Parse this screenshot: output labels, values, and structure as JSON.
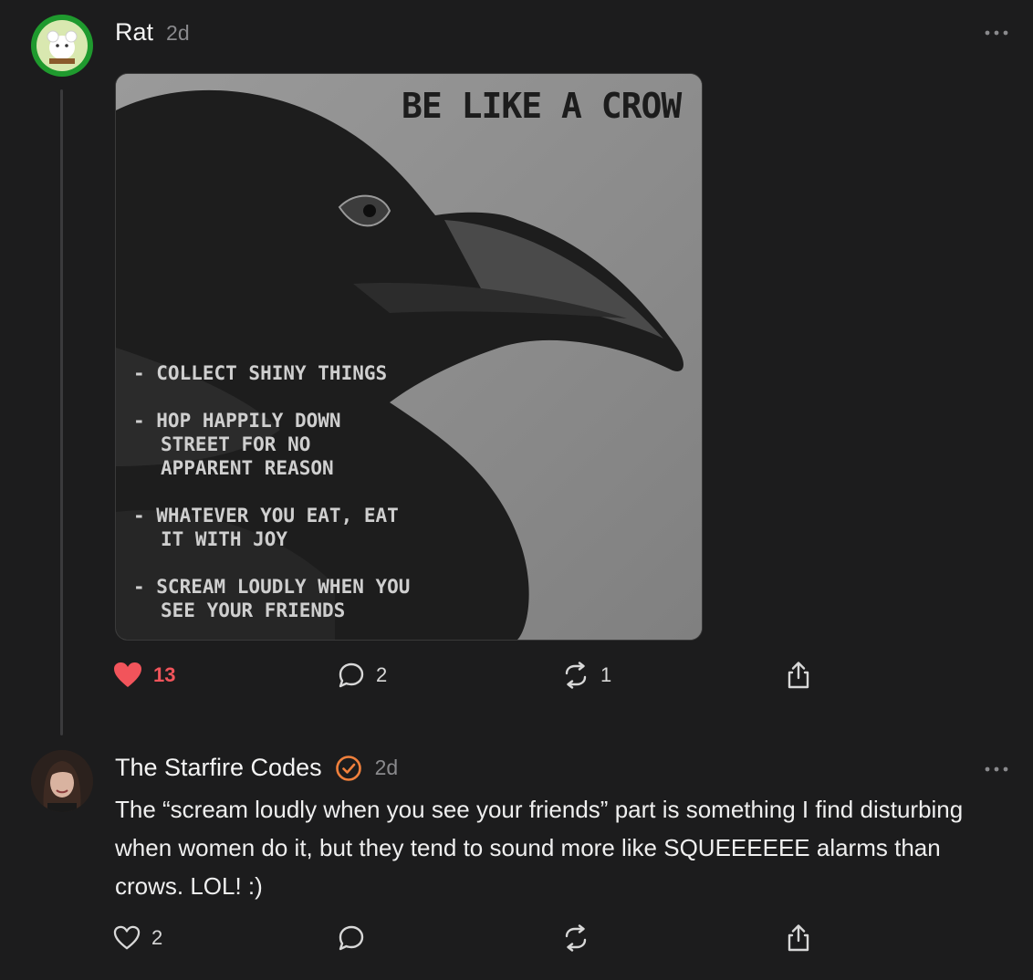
{
  "post": {
    "author": "Rat",
    "time": "2d",
    "image": {
      "title": "BE LIKE A CROW",
      "lines": [
        "- COLLECT SHINY THINGS",
        "- HOP HAPPILY DOWN",
        "STREET FOR NO",
        "APPARENT REASON",
        "- WHATEVER YOU EAT, EAT",
        "IT WITH JOY",
        "- SCREAM LOUDLY WHEN YOU",
        "SEE YOUR FRIENDS"
      ]
    },
    "likes": "13",
    "comments": "2",
    "restacks": "1"
  },
  "reply": {
    "author": "The Starfire Codes",
    "time": "2d",
    "text": "The “scream loudly when you see your friends” part is something I find disturbing when women do it, but they tend to sound more like SQUEEEEEE alarms than crows. LOL! :)",
    "likes": "2"
  },
  "colors": {
    "background": "#1c1c1d",
    "like_active": "#f2545b",
    "verified": "#f0803c"
  }
}
